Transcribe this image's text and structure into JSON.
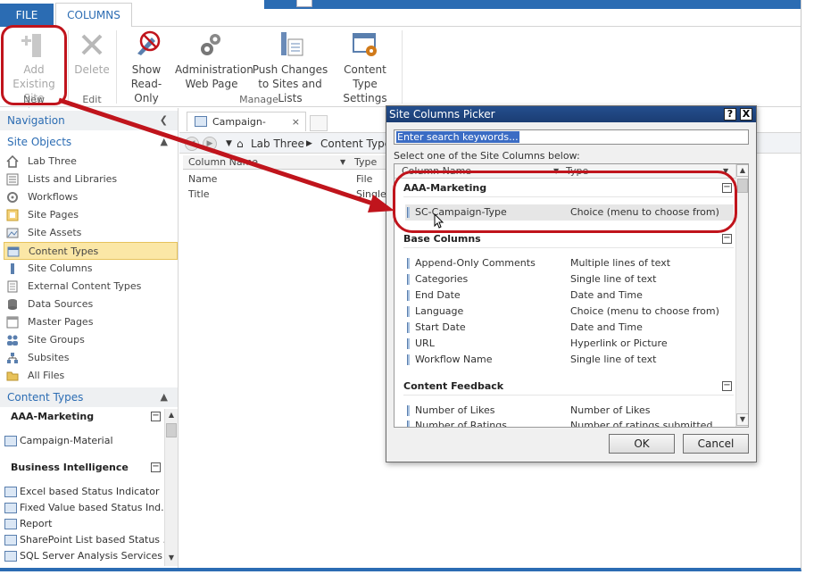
{
  "tabs": {
    "file": "FILE",
    "columns": "COLUMNS"
  },
  "ribbon": {
    "add_existing": "Add Existing Site Column",
    "delete": "Delete",
    "show_readonly": "Show Read-Only",
    "admin_page": "Administration Web Page",
    "push_changes": "Push Changes to Sites and Lists",
    "ct_settings": "Content Type Settings",
    "groups": {
      "new": "New",
      "edit": "Edit",
      "manage": "Manage"
    }
  },
  "nav": {
    "header": "Navigation",
    "site_objects": "Site Objects",
    "items": [
      "Lab Three",
      "Lists and Libraries",
      "Workflows",
      "Site Pages",
      "Site Assets",
      "Content Types",
      "Site Columns",
      "External Content Types",
      "Data Sources",
      "Master Pages",
      "Site Groups",
      "Subsites",
      "All Files"
    ],
    "selected": "Content Types",
    "content_types_header": "Content Types",
    "groups": [
      {
        "name": "AAA-Marketing",
        "items": [
          "Campaign-Material"
        ]
      },
      {
        "name": "Business Intelligence",
        "items": [
          "Excel based Status Indicator",
          "Fixed Value based Status Ind...",
          "Report",
          "SharePoint List based Status ...",
          "SQL Server Analysis Services ..."
        ]
      }
    ]
  },
  "main": {
    "doc_tab": "Campaign-Material",
    "breadcrumb": [
      "Lab Three",
      "Content Type"
    ],
    "grid_headers": [
      "Column Name",
      "Type"
    ],
    "rows": [
      {
        "name": "Name",
        "type": "File"
      },
      {
        "name": "Title",
        "type": "Single"
      }
    ]
  },
  "dialog": {
    "title": "Site Columns Picker",
    "help": "?",
    "close": "X",
    "search_placeholder": "Enter search keywords...",
    "instruction": "Select one of the Site Columns below:",
    "col_headers": [
      "Column Name",
      "Type"
    ],
    "groups": [
      {
        "name": "AAA-Marketing",
        "rows": [
          {
            "name": "SC-Campaign-Type",
            "type": "Choice (menu to choose from)"
          }
        ]
      },
      {
        "name": "Base Columns",
        "rows": [
          {
            "name": "Append-Only Comments",
            "type": "Multiple lines of text"
          },
          {
            "name": "Categories",
            "type": "Single line of text"
          },
          {
            "name": "End Date",
            "type": "Date and Time"
          },
          {
            "name": "Language",
            "type": "Choice (menu to choose from)"
          },
          {
            "name": "Start Date",
            "type": "Date and Time"
          },
          {
            "name": "URL",
            "type": "Hyperlink or Picture"
          },
          {
            "name": "Workflow Name",
            "type": "Single line of text"
          }
        ]
      },
      {
        "name": "Content Feedback",
        "rows": [
          {
            "name": "Number of Likes",
            "type": "Number of Likes"
          },
          {
            "name": "Number of Ratings",
            "type": "Number of ratings submitted"
          }
        ]
      }
    ],
    "ok": "OK",
    "cancel": "Cancel"
  },
  "colors": {
    "accent": "#2b6cb3",
    "annotation": "#c0141c",
    "selected_nav": "#fbe7a6"
  }
}
